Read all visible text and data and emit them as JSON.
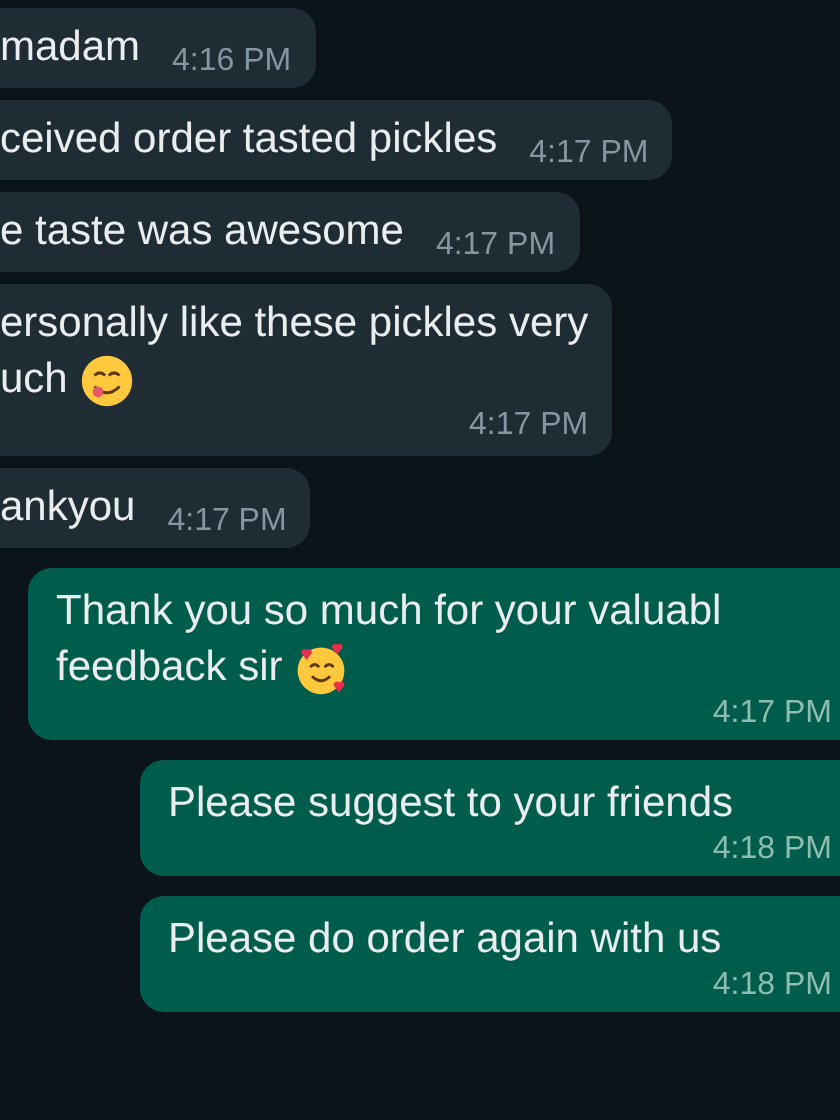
{
  "messages": [
    {
      "kind": "received",
      "text": "madam",
      "time": "4:16 PM"
    },
    {
      "kind": "received",
      "text": "ceived order tasted pickles",
      "time": "4:17 PM"
    },
    {
      "kind": "received",
      "text": "e taste was awesome",
      "time": "4:17 PM"
    },
    {
      "kind": "received",
      "lines": [
        "ersonally like these pickles very",
        "uch"
      ],
      "emoji": {
        "kind": "yum"
      },
      "time": "4:17 PM"
    },
    {
      "kind": "received",
      "text": "ankyou",
      "time": "4:17 PM"
    },
    {
      "kind": "sent",
      "lines": [
        "Thank you so much for your valuabl",
        "feedback sir"
      ],
      "emoji": {
        "kind": "hearts"
      },
      "time": "4:17 PM"
    },
    {
      "kind": "sent",
      "text": "Please suggest to your friends",
      "time": "4:18 PM"
    },
    {
      "kind": "sent",
      "text": "Please do order again with us",
      "time": "4:18 PM"
    }
  ]
}
